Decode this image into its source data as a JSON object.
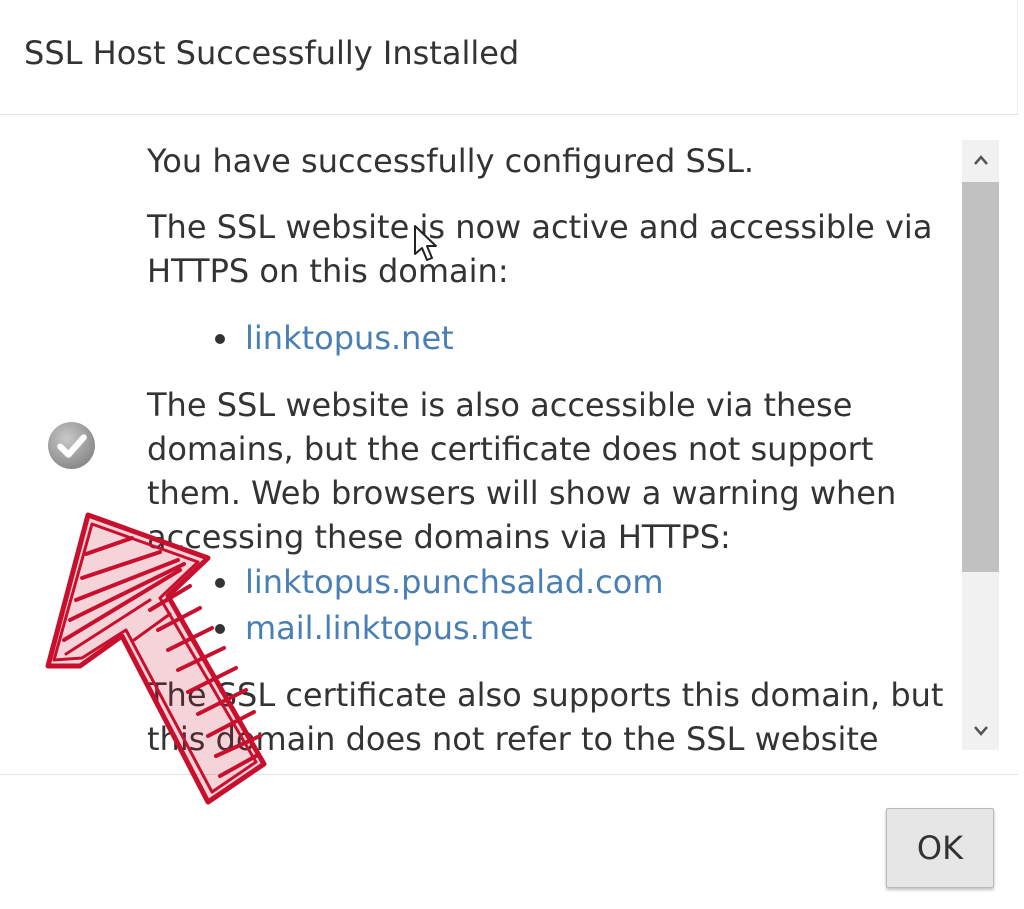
{
  "dialog": {
    "title": "SSL Host Successfully Installed",
    "intro": "You have successfully configured SSL.",
    "active_text": "The SSL website is now active and accessible via HTTPS on this domain:",
    "primary_domains": [
      "linktopus.net"
    ],
    "also_text": "The SSL website is also accessible via these domains, but the certificate does not support them. Web browsers will show a warning when accessing these domains via HTTPS:",
    "other_domains": [
      "linktopus.punchsalad.com",
      "mail.linktopus.net"
    ],
    "cert_text": "The SSL certificate also supports this domain, but this domain does not refer to the SSL website",
    "ok_label": "OK"
  },
  "icons": {
    "status": "check-circle-icon",
    "scroll_up": "chevron-up-icon",
    "scroll_down": "chevron-down-icon",
    "annotation": "hand-drawn-arrow-annotation",
    "cursor": "mouse-pointer-icon"
  },
  "colors": {
    "link": "#4a7fb5",
    "text": "#333333",
    "annotation": "#c8102e",
    "check_icon": "#9a9a9a"
  }
}
